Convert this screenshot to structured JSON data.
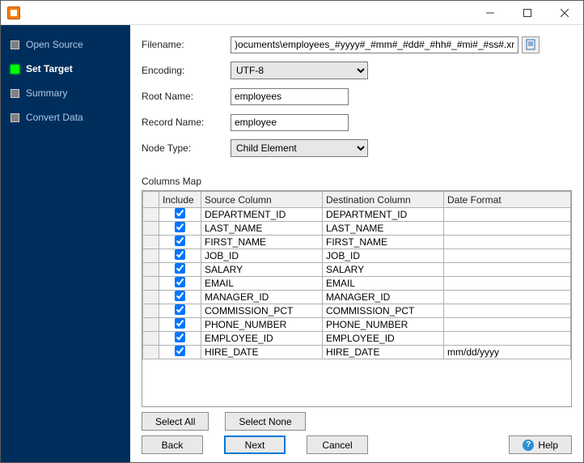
{
  "sidebar": {
    "items": [
      {
        "label": "Open Source",
        "active": false
      },
      {
        "label": "Set Target",
        "active": true
      },
      {
        "label": "Summary",
        "active": false
      },
      {
        "label": "Convert Data",
        "active": false
      }
    ]
  },
  "form": {
    "filename_label": "Filename:",
    "filename_value": ")ocuments\\employees_#yyyy#_#mm#_#dd#_#hh#_#mi#_#ss#.xml",
    "encoding_label": "Encoding:",
    "encoding_value": "UTF-8",
    "root_label": "Root Name:",
    "root_value": "employees",
    "record_label": "Record Name:",
    "record_value": "employee",
    "node_label": "Node Type:",
    "node_value": "Child Element"
  },
  "grid": {
    "section_label": "Columns Map",
    "headers": {
      "include": "Include",
      "source": "Source Column",
      "dest": "Destination Column",
      "fmt": "Date Format"
    },
    "rows": [
      {
        "include": true,
        "source": "DEPARTMENT_ID",
        "dest": "DEPARTMENT_ID",
        "fmt": ""
      },
      {
        "include": true,
        "source": "LAST_NAME",
        "dest": "LAST_NAME",
        "fmt": ""
      },
      {
        "include": true,
        "source": "FIRST_NAME",
        "dest": "FIRST_NAME",
        "fmt": ""
      },
      {
        "include": true,
        "source": "JOB_ID",
        "dest": "JOB_ID",
        "fmt": ""
      },
      {
        "include": true,
        "source": "SALARY",
        "dest": "SALARY",
        "fmt": ""
      },
      {
        "include": true,
        "source": "EMAIL",
        "dest": "EMAIL",
        "fmt": ""
      },
      {
        "include": true,
        "source": "MANAGER_ID",
        "dest": "MANAGER_ID",
        "fmt": ""
      },
      {
        "include": true,
        "source": "COMMISSION_PCT",
        "dest": "COMMISSION_PCT",
        "fmt": ""
      },
      {
        "include": true,
        "source": "PHONE_NUMBER",
        "dest": "PHONE_NUMBER",
        "fmt": ""
      },
      {
        "include": true,
        "source": "EMPLOYEE_ID",
        "dest": "EMPLOYEE_ID",
        "fmt": ""
      },
      {
        "include": true,
        "source": "HIRE_DATE",
        "dest": "HIRE_DATE",
        "fmt": "mm/dd/yyyy"
      }
    ]
  },
  "buttons": {
    "select_all": "Select All",
    "select_none": "Select None",
    "back": "Back",
    "next": "Next",
    "cancel": "Cancel",
    "help": "Help"
  }
}
